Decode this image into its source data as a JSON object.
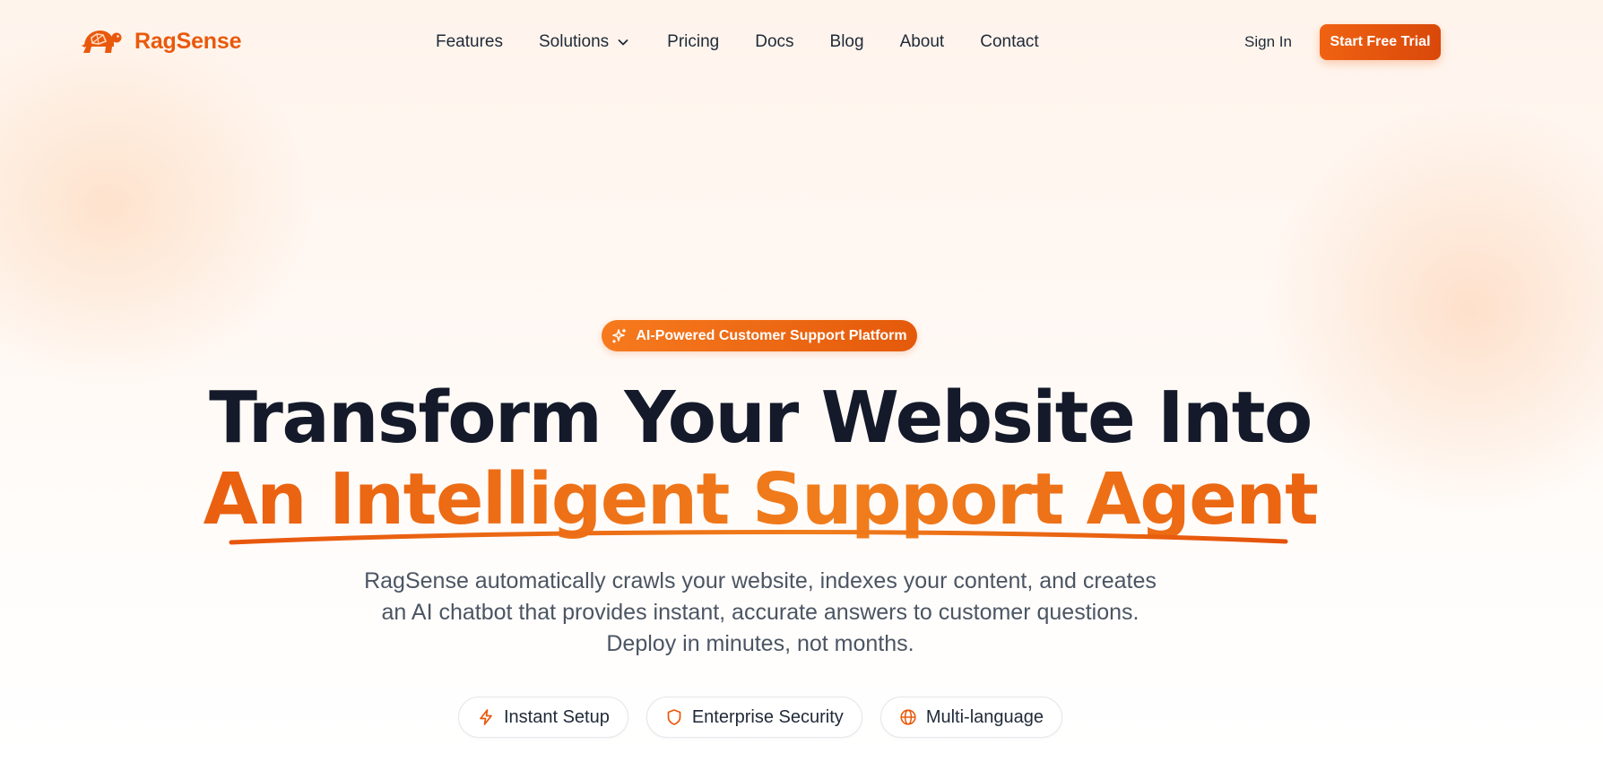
{
  "brand": {
    "name": "RagSense",
    "logo_icon": "turtle-icon",
    "color": "#e9590c"
  },
  "nav": {
    "items": [
      {
        "label": "Features"
      },
      {
        "label": "Solutions",
        "has_dropdown": true,
        "icon": "chevron-down-icon"
      },
      {
        "label": "Pricing"
      },
      {
        "label": "Docs"
      },
      {
        "label": "Blog"
      },
      {
        "label": "About"
      },
      {
        "label": "Contact"
      }
    ],
    "sign_in": "Sign In",
    "cta": "Start Free Trial"
  },
  "hero": {
    "badge": {
      "label": "AI-Powered Customer Support Platform",
      "icon": "sparkles-icon"
    },
    "title_line1": "Transform Your Website Into",
    "title_line2": "An Intelligent Support Agent",
    "subtitle_lines": [
      "RagSense automatically crawls your website, indexes your content, and creates",
      "an AI chatbot that provides instant, accurate answers to customer questions.",
      "Deploy in minutes, not months."
    ],
    "features": [
      {
        "label": "Instant Setup",
        "icon": "lightning-icon"
      },
      {
        "label": "Enterprise Security",
        "icon": "shield-icon"
      },
      {
        "label": "Multi-language",
        "icon": "globe-icon"
      }
    ]
  },
  "colors": {
    "accent": "#ea580c",
    "heading": "#141a2a",
    "text": "#4b5563"
  }
}
